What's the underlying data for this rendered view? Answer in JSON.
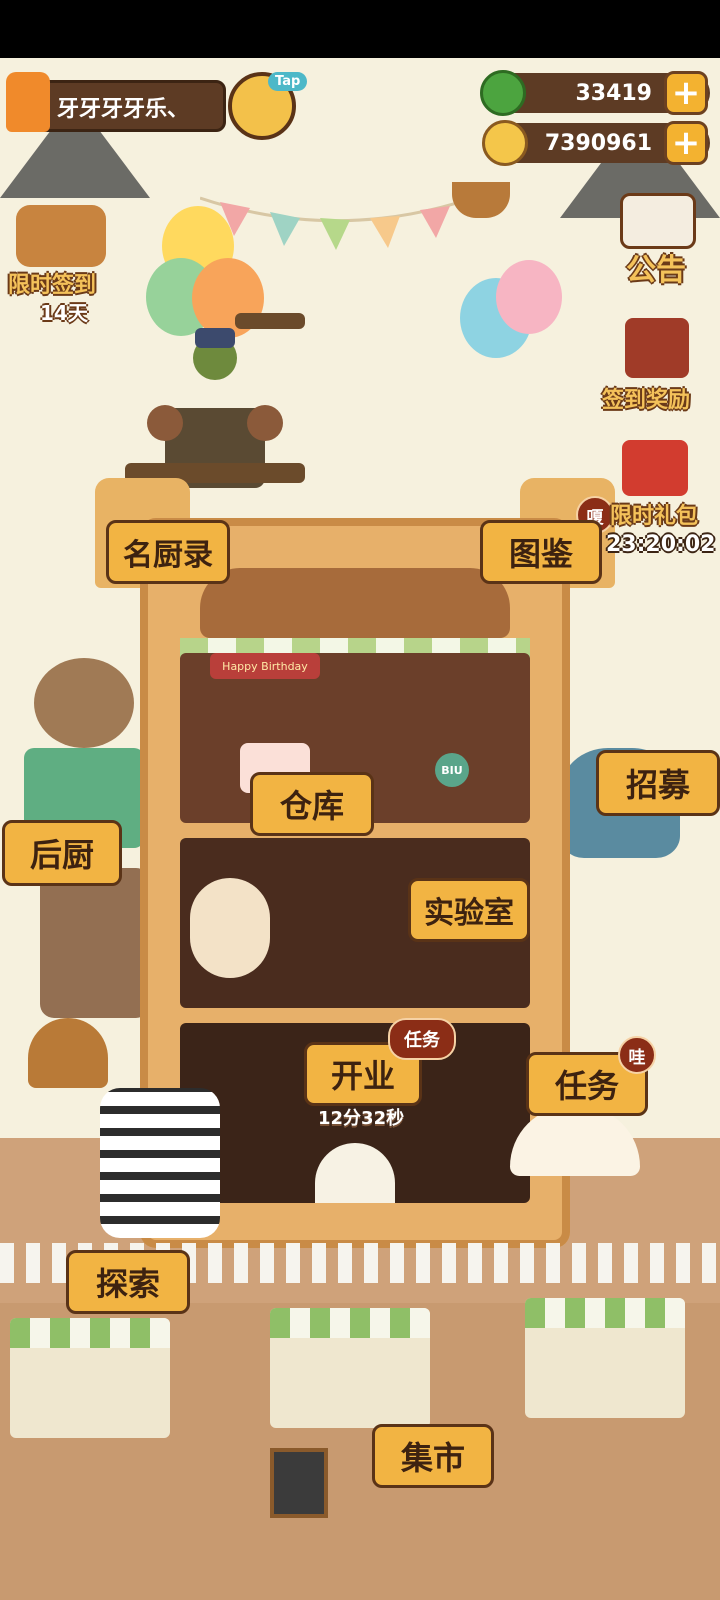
{
  "player": {
    "name": "牙牙牙牙乐、",
    "tap_label": "Tap"
  },
  "currency": {
    "cookies": "33419",
    "coins": "7390961"
  },
  "left_events": {
    "daily_signin_label": "限时签到",
    "daily_signin_days": "14天"
  },
  "right_menu": {
    "announcement": "公告",
    "signin_reward": "签到奖励",
    "limited_gift": "限时礼包",
    "limited_gift_timer": "23:20:02",
    "limited_gift_badge": "嗄"
  },
  "building": {
    "famous_chefs": "名厨录",
    "encyclopedia": "图鉴",
    "warehouse": "仓库",
    "recruit": "招募",
    "back_kitchen": "后厨",
    "lab": "实验室",
    "open_business": "开业",
    "open_business_badge": "任务",
    "open_business_timer": "12分32秒",
    "tasks": "任务",
    "tasks_badge": "哇",
    "banner_text": "Happy Birthday",
    "biu_text": "BIU"
  },
  "bottom": {
    "explore": "探索",
    "market": "集市"
  },
  "colors": {
    "button_fill": "#f2b443",
    "button_border": "#5a3317",
    "badge": "#8b2d16",
    "hud_pill": "#5d3b24"
  }
}
